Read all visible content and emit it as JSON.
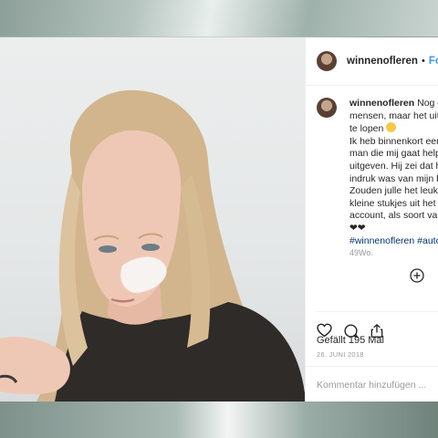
{
  "post": {
    "username": "winnenofleren",
    "follow_label": "Folg",
    "separator": "•",
    "caption_lines": [
      "Nog e",
      "mensen, maar het uit",
      "te lopen",
      "Ik heb binnenkort een",
      "man die mij gaat help",
      "uitgeven. Hij zei dat h",
      "indruk was van mijn b",
      "Zouden julle het leuk",
      "kleine stukjes uit het",
      "account, als soort var",
      "❤❤"
    ],
    "hashtags": "#winnenofleren #auto",
    "caption_time": "49Wo.",
    "likes": "Gefällt 195 Mal",
    "date": "26. JUNI 2018",
    "comment_placeholder": "Kommentar hinzufügen ..."
  },
  "icons": {
    "like": "heart-icon",
    "comment": "comment-icon",
    "share": "share-icon",
    "add": "plus-circle-icon"
  },
  "colors": {
    "follow": "#3897f0",
    "hashtag": "#003569",
    "meta": "#999999"
  }
}
